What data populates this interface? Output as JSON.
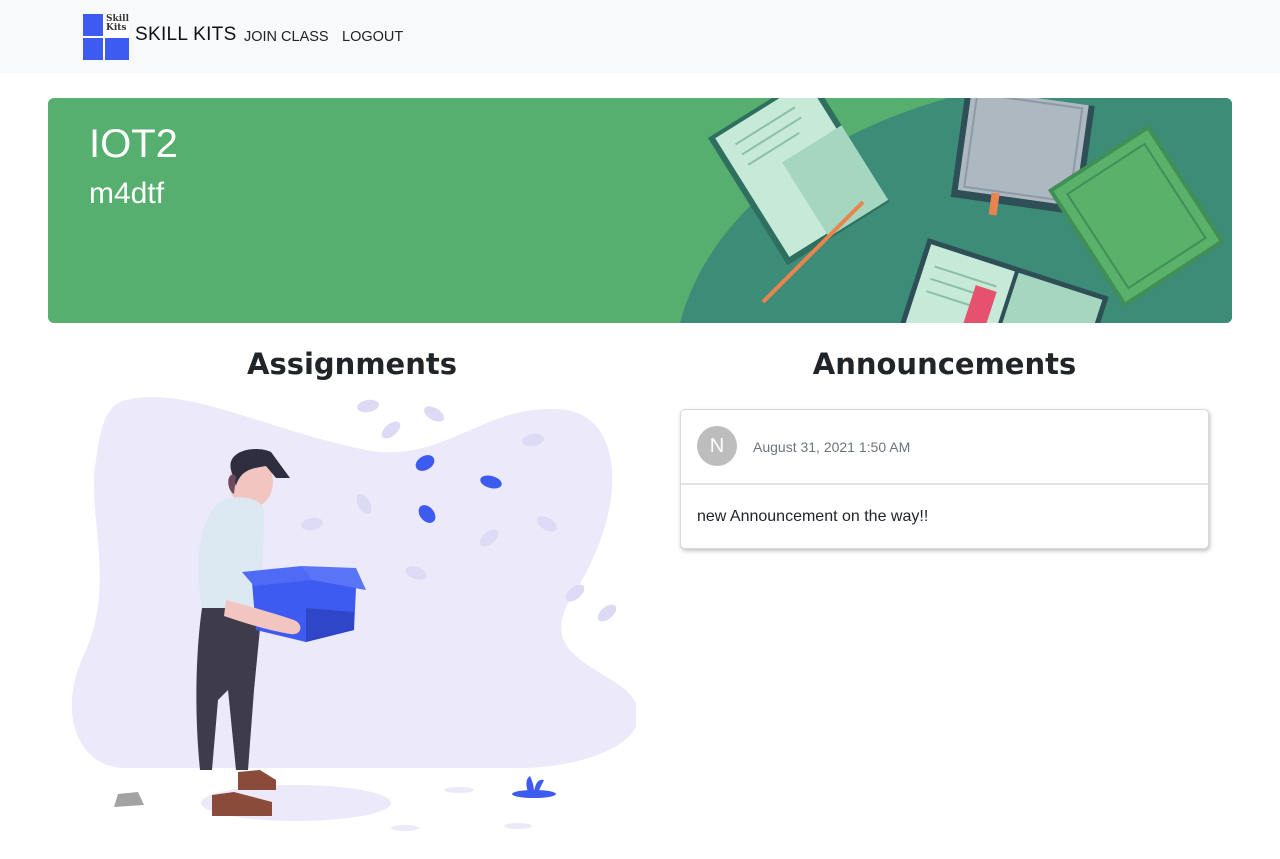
{
  "nav": {
    "logo_text_1": "Skill",
    "logo_text_2": "Kits",
    "brand": "SKILL KITS",
    "links": [
      "JOIN CLASS",
      "LOGOUT"
    ]
  },
  "banner": {
    "class_name": "IOT2",
    "class_code": "m4dtf",
    "color": "#56ae6f"
  },
  "assignments": {
    "title": "Assignments"
  },
  "announcements": {
    "title": "Announcements",
    "items": [
      {
        "avatar_letter": "N",
        "date": "August 31, 2021 1:50 AM",
        "text": "new Announcement on the way!!"
      }
    ]
  },
  "colors": {
    "accent": "#3d5af1",
    "navbar_bg": "#f8f9fa"
  }
}
